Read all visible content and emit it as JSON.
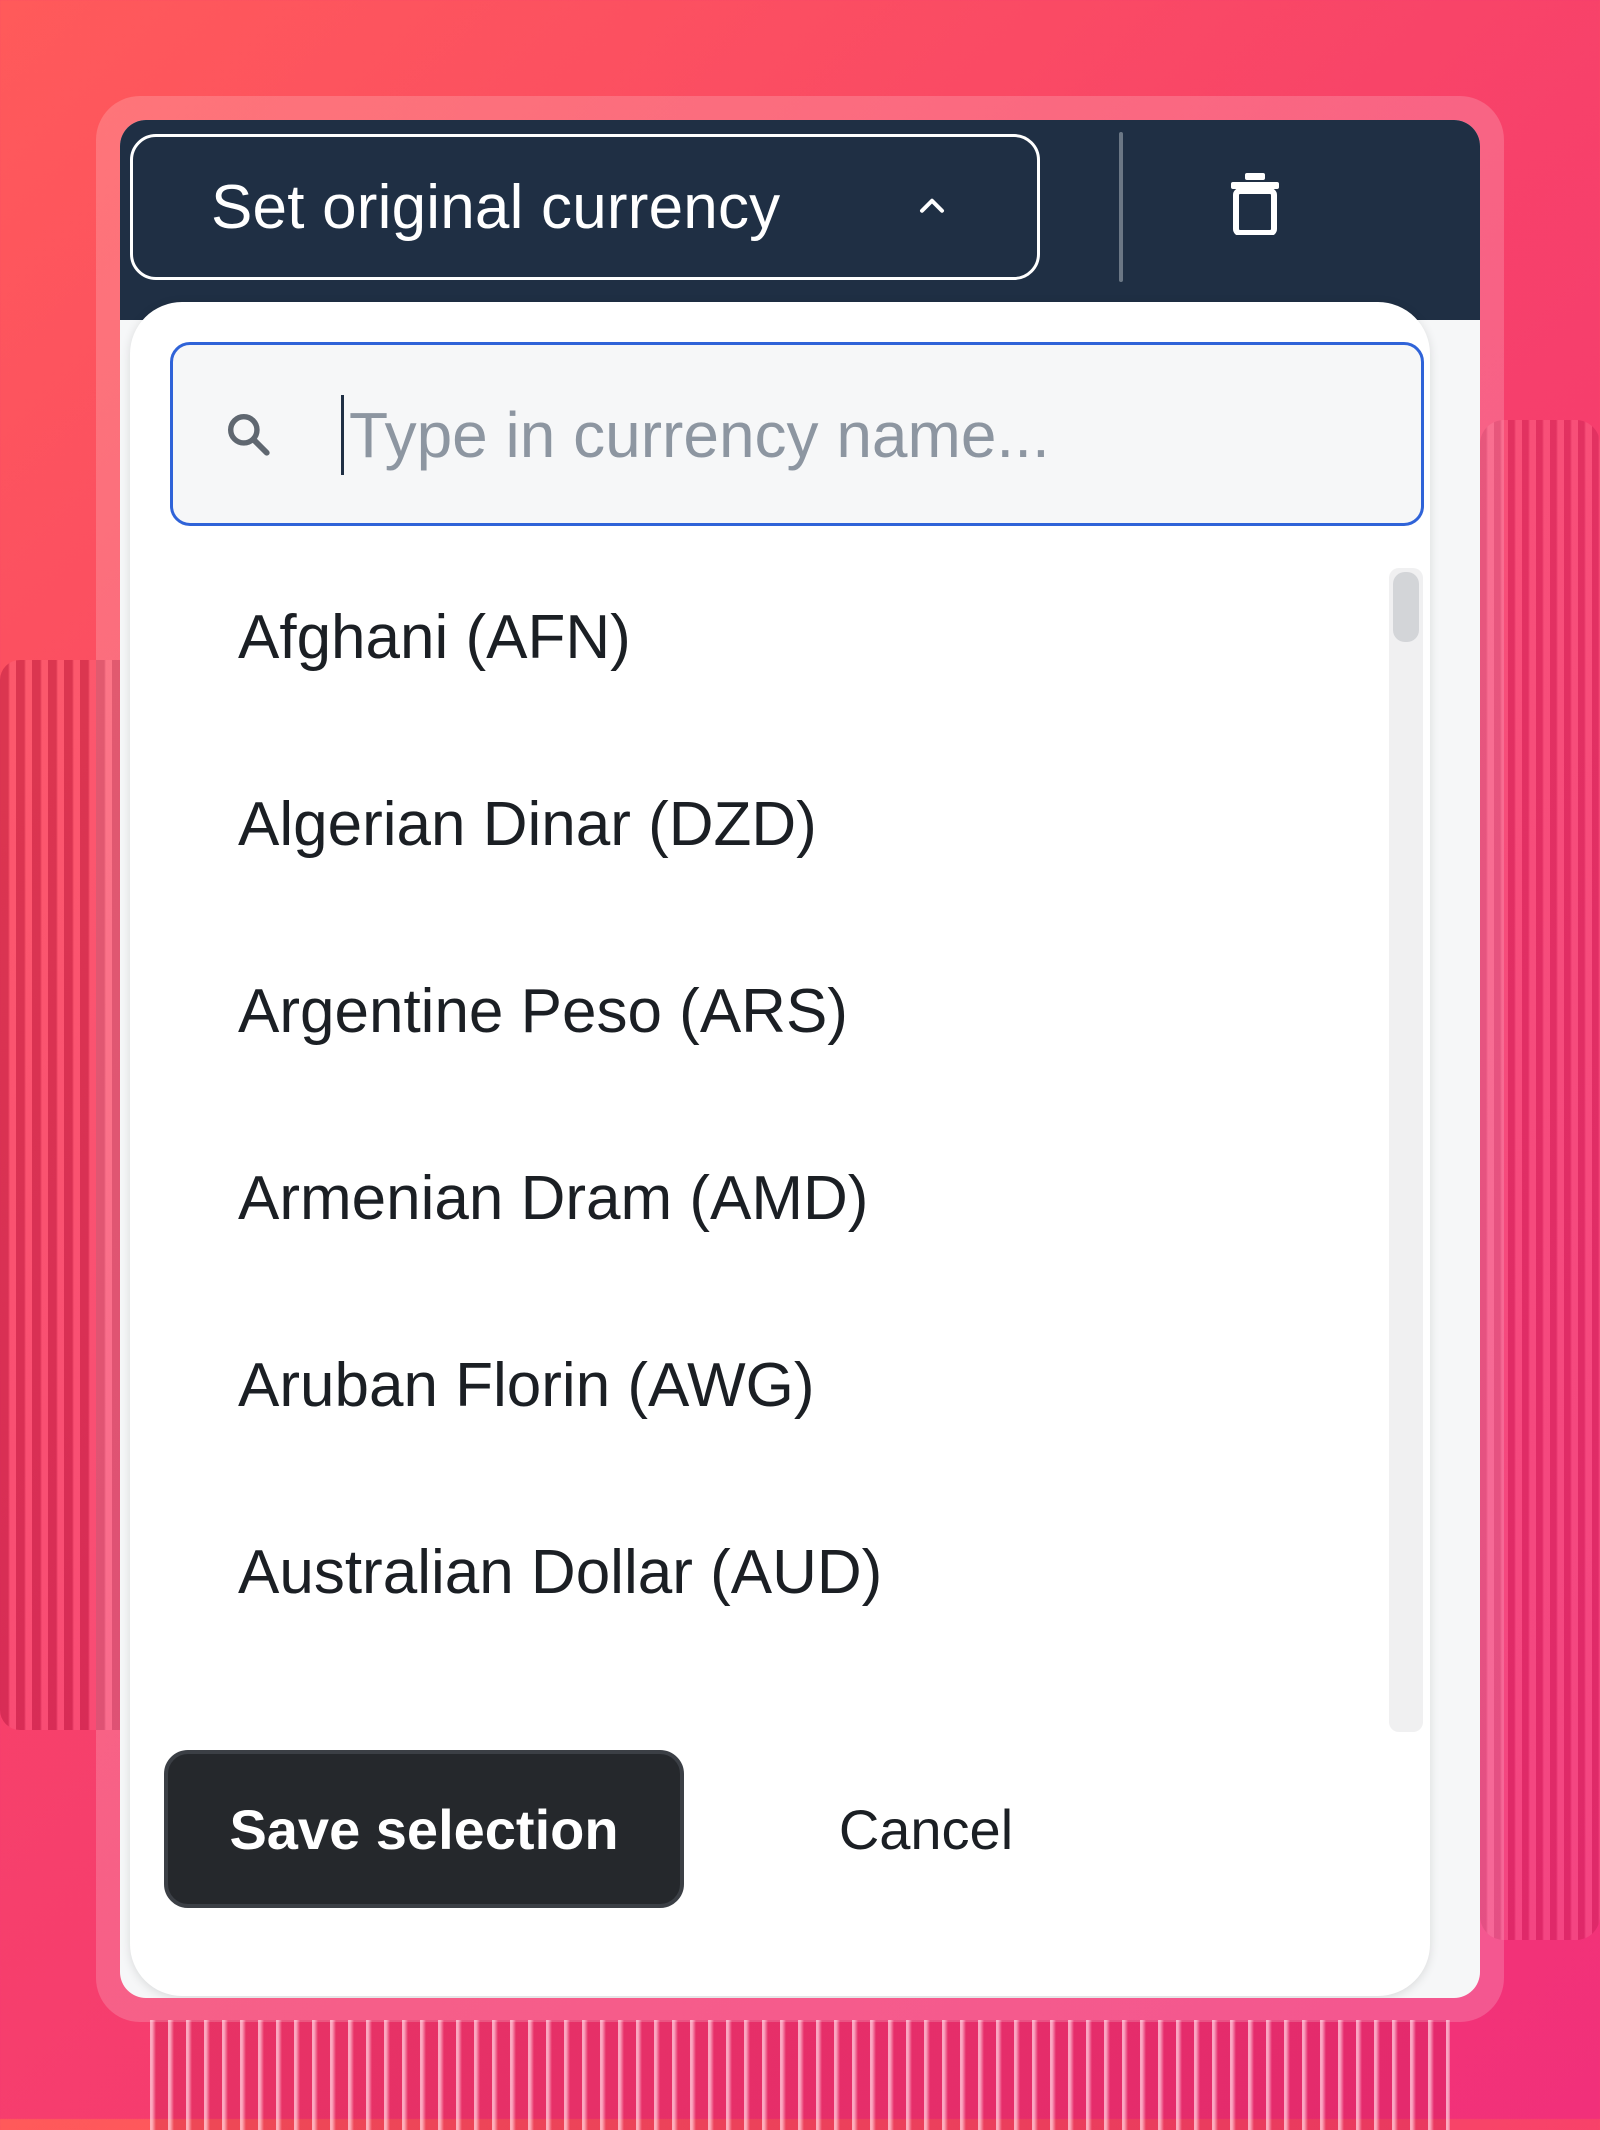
{
  "colors": {
    "background_gradient_start": "#ff5a5a",
    "background_gradient_end": "#f1307a",
    "topbar": "#1f2f44",
    "search_focus": "#2f63d8",
    "save_button": "#25282c"
  },
  "toolbar": {
    "currency_toggle_label": "Set original currency",
    "currency_toggle_icon": "chevron-up-icon",
    "trash_icon": "trash-icon"
  },
  "dropdown": {
    "search": {
      "value": "",
      "placeholder": "Type in currency name...",
      "icon": "search-icon"
    },
    "items": [
      {
        "label": "Afghani (AFN)"
      },
      {
        "label": "Algerian Dinar (DZD)"
      },
      {
        "label": "Argentine Peso (ARS)"
      },
      {
        "label": "Armenian Dram (AMD)"
      },
      {
        "label": "Aruban Florin (AWG)"
      },
      {
        "label": "Australian Dollar (AUD)"
      }
    ],
    "footer": {
      "save_label": "Save selection",
      "cancel_label": "Cancel"
    }
  }
}
